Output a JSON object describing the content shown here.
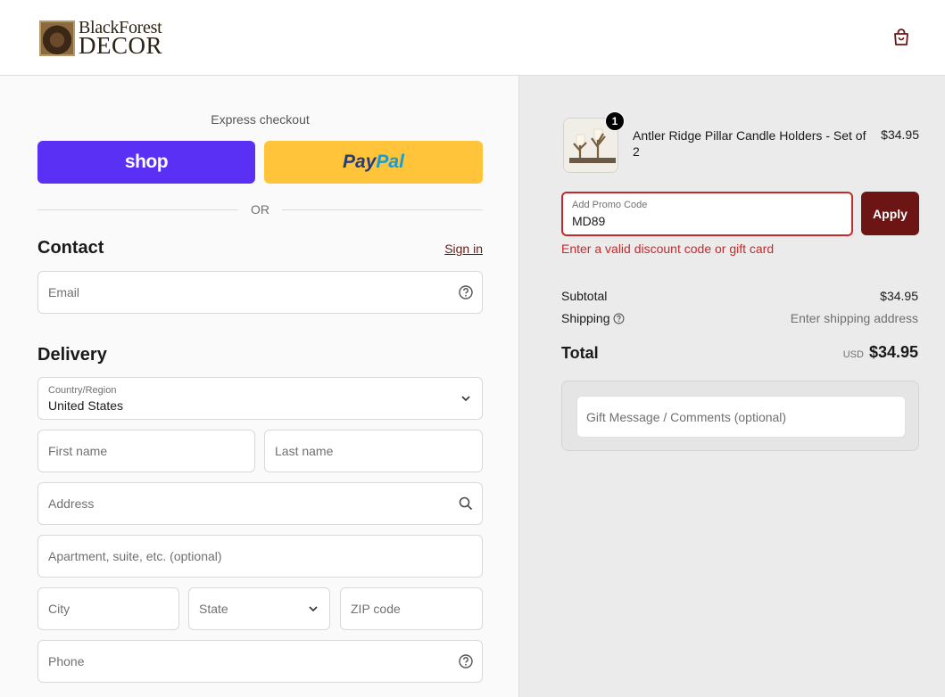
{
  "header": {
    "logo_top": "BlackForest",
    "logo_bottom": "DECOR"
  },
  "express": {
    "label": "Express checkout",
    "shop_label": "shop",
    "paypal_part1": "Pay",
    "paypal_part2": "Pal",
    "or_label": "OR"
  },
  "contact": {
    "heading": "Contact",
    "signin_label": "Sign in",
    "email_placeholder": "Email"
  },
  "delivery": {
    "heading": "Delivery",
    "country_label": "Country/Region",
    "country_value": "United States",
    "first_name_placeholder": "First name",
    "last_name_placeholder": "Last name",
    "address_placeholder": "Address",
    "apartment_placeholder": "Apartment, suite, etc. (optional)",
    "city_placeholder": "City",
    "state_placeholder": "State",
    "zip_placeholder": "ZIP code",
    "phone_placeholder": "Phone"
  },
  "summary": {
    "item": {
      "name": "Antler Ridge Pillar Candle Holders - Set of 2",
      "quantity": "1",
      "price": "$34.95"
    },
    "promo": {
      "label": "Add Promo Code",
      "value": "MD89",
      "apply_label": "Apply",
      "error": "Enter a valid discount code or gift card"
    },
    "subtotal_label": "Subtotal",
    "subtotal_value": "$34.95",
    "shipping_label": "Shipping",
    "shipping_value": "Enter shipping address",
    "total_label": "Total",
    "currency": "USD",
    "total_value": "$34.95",
    "gift_placeholder": "Gift Message / Comments (optional)"
  },
  "colors": {
    "shop": "#5a31f4",
    "paypal": "#ffc439",
    "accent": "#6d1515",
    "error": "#c6292c"
  }
}
